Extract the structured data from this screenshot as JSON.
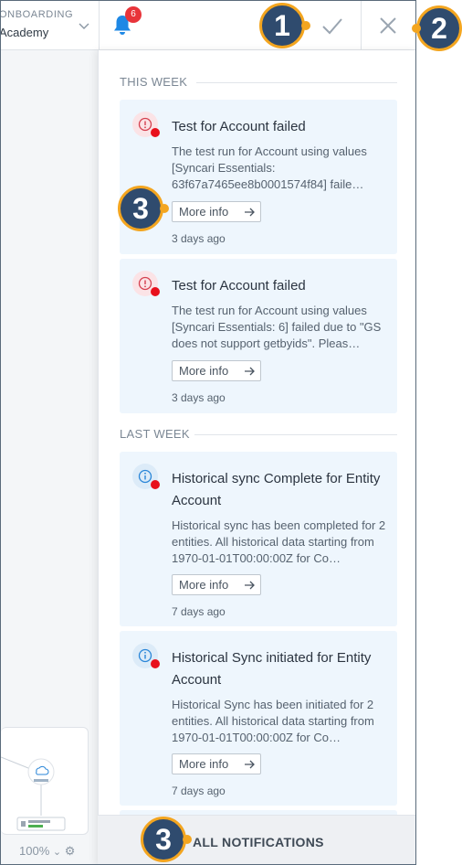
{
  "topbar": {
    "onboarding_label": "ONBOARDING",
    "onboarding_value": "Academy",
    "badge_count": "6"
  },
  "canvas": {
    "zoom_label": "100%"
  },
  "sections": [
    {
      "label": "THIS WEEK"
    },
    {
      "label": "LAST WEEK"
    }
  ],
  "notifications": [
    {
      "title": "Test for Account failed",
      "body": "The test run for Account using values [Syncari Essentials: 63f67a7465ee8b0001574f84] faile…",
      "more_label": "More info",
      "time": "3 days ago",
      "status": "error"
    },
    {
      "title": "Test for Account failed",
      "body": "The test run for Account using values [Syncari Essentials: 6] failed due to \"GS does not support getbyids\". Pleas…",
      "more_label": "More info",
      "time": "3 days ago",
      "status": "error"
    },
    {
      "title": "Historical sync Complete for Entity Account",
      "body": "Historical sync has been completed for 2 entities. All historical data starting from 1970-01-01T00:00:00Z for Co…",
      "more_label": "More info",
      "time": "7 days ago",
      "status": "info"
    },
    {
      "title": "Historical Sync initiated for Entity Account",
      "body": "Historical Sync has been initiated for 2 entities. All historical data starting from 1970-01-01T00:00:00Z for Co…",
      "more_label": "More info",
      "time": "7 days ago",
      "status": "info"
    }
  ],
  "footer": {
    "all_notifications_label": "ALL NOTIFICATIONS"
  },
  "callouts": {
    "mark_read": "1",
    "close": "2",
    "more_info": "3",
    "all_notifications": "3"
  },
  "colors": {
    "accent_blue": "#1e88e5",
    "error_red": "#e8101c",
    "callout_fill": "#2f4b6e",
    "callout_ring": "#f3a51f"
  },
  "icons": {
    "bell": "bell-icon",
    "check": "check-icon",
    "close": "close-icon",
    "error": "error-icon",
    "info": "info-icon",
    "arrow": "arrow-right-icon"
  }
}
